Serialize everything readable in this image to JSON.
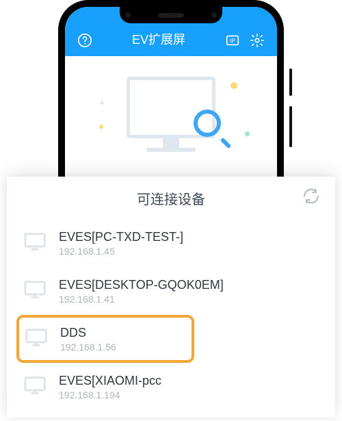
{
  "header": {
    "title": "EV扩展屏"
  },
  "sheet": {
    "title": "可连接设备"
  },
  "devices": [
    {
      "name": "EVES[PC-TXD-TEST-]",
      "ip": "192.168.1.45",
      "highlighted": false
    },
    {
      "name": "EVES[DESKTOP-GQOK0EM]",
      "ip": "192.168.1.41",
      "highlighted": false
    },
    {
      "name": "DDS",
      "ip": "192.168.1.56",
      "highlighted": true
    },
    {
      "name": "EVES[XIAOMI-pcc",
      "ip": "192.168.1.194",
      "highlighted": false
    }
  ],
  "colors": {
    "accent": "#18a0ff",
    "highlight": "#f2a635"
  }
}
